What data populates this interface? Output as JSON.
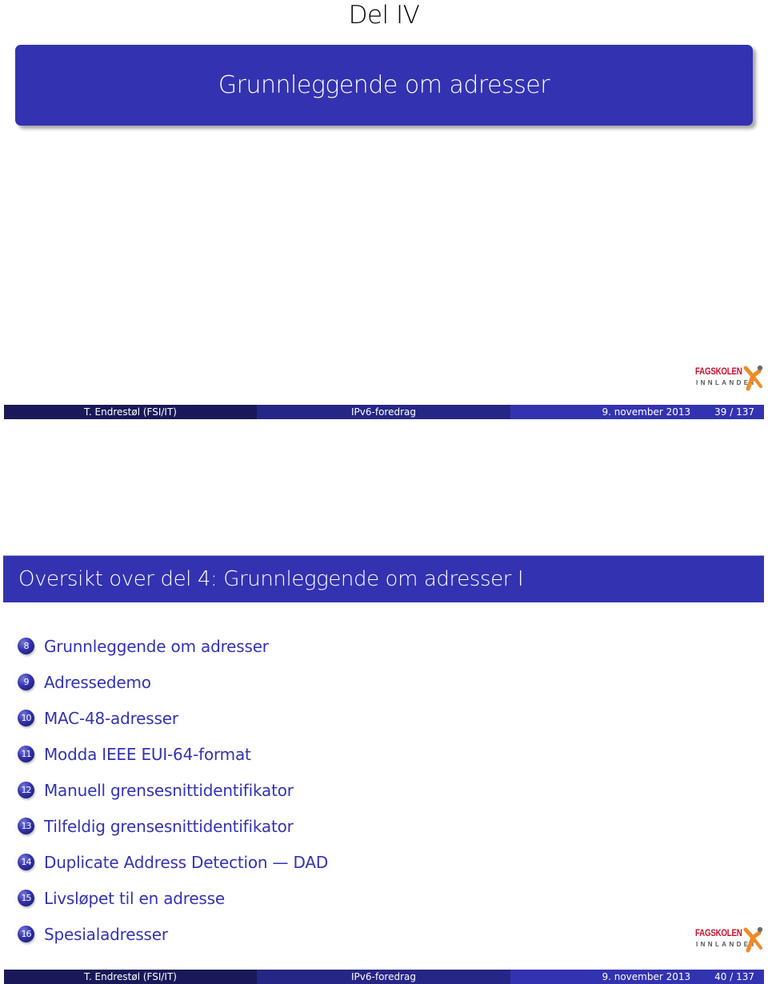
{
  "slides": [
    {
      "part_label": "Del IV",
      "part_title": "Grunnleggende om adresser",
      "logo": {
        "line1": "FAGSKOLEN",
        "line2": "INNLANDET",
        "icon": "running-figure-icon"
      },
      "footer": {
        "author": "T. Endrestøl  (FSI/IT)",
        "title": "IPv6-foredrag",
        "date": "9. november 2013",
        "pages": "39 / 137"
      }
    },
    {
      "frame_title": "Oversikt over del 4: Grunnleggende om adresser I",
      "toc": [
        {
          "num": "8",
          "label": "Grunnleggende om adresser"
        },
        {
          "num": "9",
          "label": "Adressedemo"
        },
        {
          "num": "10",
          "label": "MAC-48-adresser"
        },
        {
          "num": "11",
          "label": "Modda IEEE EUI-64-format"
        },
        {
          "num": "12",
          "label": "Manuell grensesnittidentifikator"
        },
        {
          "num": "13",
          "label": "Tilfeldig grensesnittidentifikator"
        },
        {
          "num": "14",
          "label": "Duplicate Address Detection — DAD"
        },
        {
          "num": "15",
          "label": "Livsløpet til en adresse"
        },
        {
          "num": "16",
          "label": "Spesialadresser"
        }
      ],
      "logo": {
        "line1": "FAGSKOLEN",
        "line2": "INNLANDET",
        "icon": "running-figure-icon"
      },
      "footer": {
        "author": "T. Endrestøl  (FSI/IT)",
        "title": "IPv6-foredrag",
        "date": "9. november 2013",
        "pages": "40 / 137"
      }
    }
  ],
  "colors": {
    "beamer_blue": "#3333b2",
    "footer_dark": "#191959",
    "footer_mid": "#262686",
    "logo_red": "#c8102e",
    "logo_orange": "#f08a24"
  }
}
